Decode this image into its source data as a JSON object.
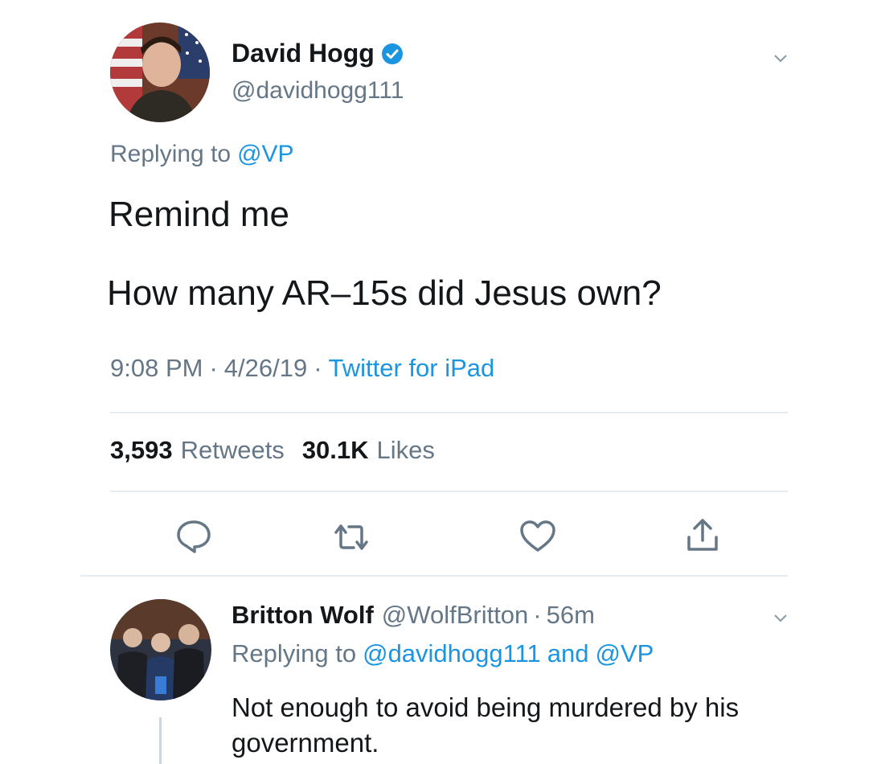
{
  "tweet": {
    "author_name": "David Hogg",
    "author_handle": "@davidhogg111",
    "verified": true,
    "replying_prefix": "Replying to",
    "replying_to": "@VP",
    "text_line1": "Remind me",
    "text_line2": "How many AR–15s did Jesus own?",
    "time": "9:08 PM",
    "date": "4/26/19",
    "sep": "·",
    "source": "Twitter for iPad",
    "retweets_count": "3,593",
    "retweets_label": "Retweets",
    "likes_count": "30.1K",
    "likes_label": "Likes"
  },
  "actions": [
    "reply-icon",
    "retweet-icon",
    "like-icon",
    "share-icon"
  ],
  "reply": {
    "author_name": "Britton Wolf",
    "author_handle": "@WolfBritton",
    "sep": "·",
    "age": "56m",
    "replying_prefix": "Replying to",
    "replying_to_1": "@davidhogg111",
    "and": "and",
    "replying_to_2": "@VP",
    "text": "Not enough to avoid being murdered by his government."
  },
  "colors": {
    "link": "#1b95e0",
    "muted": "#657786",
    "text": "#14171a",
    "divider": "#e6ecf0"
  }
}
